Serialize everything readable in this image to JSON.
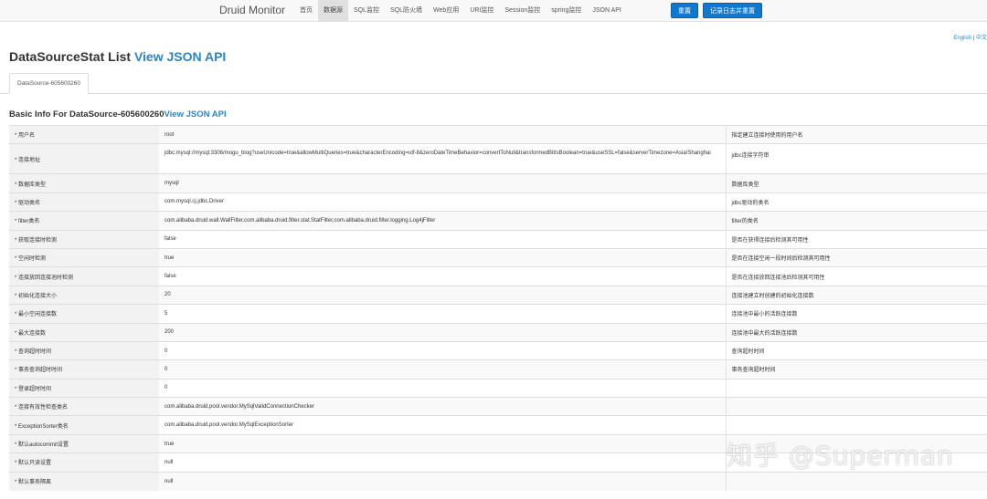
{
  "navbar": {
    "brand": "Druid Monitor",
    "items": [
      {
        "label": "首页",
        "active": false
      },
      {
        "label": "数据源",
        "active": true
      },
      {
        "label": "SQL监控",
        "active": false
      },
      {
        "label": "SQL防火墙",
        "active": false
      },
      {
        "label": "Web应用",
        "active": false
      },
      {
        "label": "URI监控",
        "active": false
      },
      {
        "label": "Session监控",
        "active": false
      },
      {
        "label": "spring监控",
        "active": false
      },
      {
        "label": "JSON API",
        "active": false
      }
    ],
    "reset_button": "重置",
    "log_reset_button": "记录日志并重置"
  },
  "language": {
    "english": "English",
    "separator": "|",
    "chinese": "中文"
  },
  "page": {
    "title": "DataSourceStat List",
    "title_link": "View JSON API"
  },
  "tabs": [
    "DataSource-605600260"
  ],
  "section": {
    "title": "Basic Info For DataSource-605600260",
    "link": "View JSON API"
  },
  "rows": [
    {
      "key": "* 用户名",
      "value": "root",
      "desc": "指定建立连接时使用的用户名"
    },
    {
      "key": "* 连接地址",
      "value": "jdbc:mysql://mysql:3306/mogu_blog?useUnicode=true&allowMultiQueries=true&characterEncoding=utf-8&zeroDateTimeBehavior=convertToNull&transformedBitIsBoolean=true&useSSL=false&serverTimezone=Asia/Shanghai",
      "desc": "jdbc连接字符串"
    },
    {
      "key": "* 数据库类型",
      "value": "mysql",
      "desc": "数据库类型"
    },
    {
      "key": "* 驱动类名",
      "value": "com.mysql.cj.jdbc.Driver",
      "desc": "jdbc驱动的类名"
    },
    {
      "key": "* filter类名",
      "value": "com.alibaba.druid.wall.WallFilter,com.alibaba.druid.filter.stat.StatFilter,com.alibaba.druid.filter.logging.Log4jFilter",
      "desc": "filter的类名"
    },
    {
      "key": "* 获取连接时检测",
      "value": "false",
      "desc": "是否在获得连接后检测其可用性"
    },
    {
      "key": "* 空闲时检测",
      "value": "true",
      "desc": "是否在连接空闲一段时间后检测其可用性"
    },
    {
      "key": "* 连接放回连接池时检测",
      "value": "false",
      "desc": "是否在连接放回连接池后检测其可用性"
    },
    {
      "key": "* 初始化连接大小",
      "value": "20",
      "desc": "连接池建立时创建的初始化连接数"
    },
    {
      "key": "* 最小空闲连接数",
      "value": "5",
      "desc": "连接池中最小的活跃连接数"
    },
    {
      "key": "* 最大连接数",
      "value": "200",
      "desc": "连接池中最大的活跃连接数"
    },
    {
      "key": "* 查询超时时间",
      "value": "0",
      "desc": "查询超时时间"
    },
    {
      "key": "* 事务查询超时时间",
      "value": "0",
      "desc": "事务查询超时时间"
    },
    {
      "key": "* 登录超时时间",
      "value": "0",
      "desc": ""
    },
    {
      "key": "* 连接有效性检查类名",
      "value": "com.alibaba.druid.pool.vendor.MySqlValidConnectionChecker",
      "desc": ""
    },
    {
      "key": "* ExceptionSorter类名",
      "value": "com.alibaba.druid.pool.vendor.MySqlExceptionSorter",
      "desc": ""
    },
    {
      "key": "* 默认autocommit设置",
      "value": "true",
      "desc": ""
    },
    {
      "key": "* 默认只读设置",
      "value": "null",
      "desc": ""
    },
    {
      "key": "* 默认事务隔离",
      "value": "null",
      "desc": ""
    }
  ],
  "watermark": "知乎 @Superman"
}
